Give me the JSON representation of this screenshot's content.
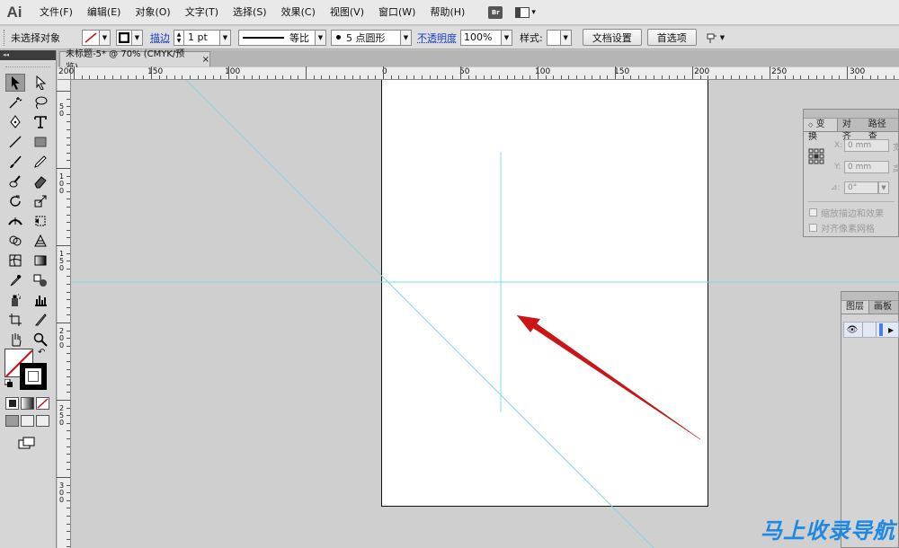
{
  "app": {
    "logo": "Ai"
  },
  "menu": [
    "文件(F)",
    "编辑(E)",
    "对象(O)",
    "文字(T)",
    "选择(S)",
    "效果(C)",
    "视图(V)",
    "窗口(W)",
    "帮助(H)"
  ],
  "menu_extras": {
    "bridge": "Br",
    "workspace_arrow": "▾"
  },
  "control": {
    "selection_status": "未选择对象",
    "stroke_label": "描边",
    "stroke_weight": "1 pt",
    "profile": "等比",
    "brush": "5 点圆形",
    "opacity_label": "不透明度",
    "opacity_value": "100%",
    "style_label": "样式:",
    "doc_setup": "文档设置",
    "preferences": "首选项"
  },
  "doc_tab": {
    "title": "未标题-5* @ 70% (CMYK/预览)",
    "close": "×"
  },
  "ruler_h": [
    "200",
    "150",
    "100",
    "0",
    "50",
    "100",
    "150",
    "200",
    "250",
    "300"
  ],
  "ruler_v": [
    "5 0",
    "1 0 0",
    "1 5 0",
    "2 0 0",
    "2 5 0",
    "3 0 0"
  ],
  "transform_panel": {
    "tabs": [
      "变换",
      "对齐",
      "路径查"
    ],
    "x_label": "X:",
    "x_value": "0 mm",
    "y_label": "Y:",
    "y_value": "0 mm",
    "w_label": "宽",
    "h_label": "高",
    "angle_value": "0°",
    "scale_strokes": "缩放描边和效果",
    "align_pixel": "对齐像素网格"
  },
  "layers_panel": {
    "tabs": [
      "图层",
      "画板"
    ]
  },
  "watermark": "马上收录导航",
  "colors": {
    "guide": "#7fd8dc",
    "arrow": "#cc1515",
    "link": "#1a3cc8",
    "watermark": "#1e88e5"
  }
}
